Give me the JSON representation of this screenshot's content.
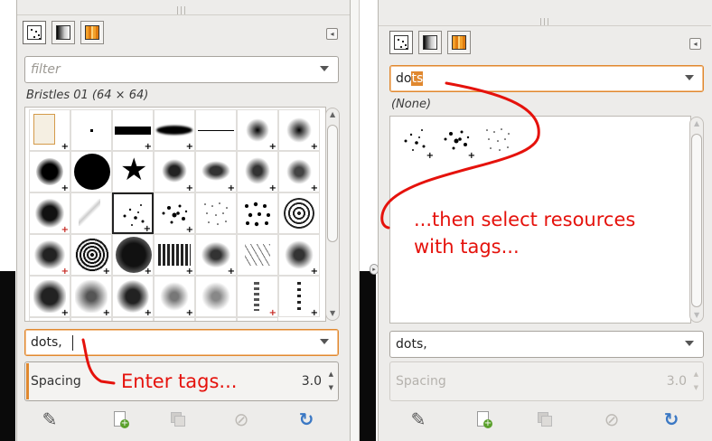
{
  "left_panel": {
    "filter": {
      "placeholder": "filter"
    },
    "selected_brush": "Bristles 01 (64 × 64)",
    "tags_field": {
      "value": "dots,"
    },
    "spacing": {
      "label": "Spacing",
      "value": "3.0"
    }
  },
  "right_panel": {
    "filter": {
      "value": "do",
      "highlight": "ts"
    },
    "selected_brush": "(None)",
    "tags_field": {
      "value": "dots,"
    },
    "spacing": {
      "label": "Spacing",
      "value": "3.0"
    }
  },
  "annotations": {
    "enter_tags": "Enter tags...",
    "select_line1": "...then select resources",
    "select_line2": "with tags..."
  },
  "colors": {
    "annotation": "#e5120c",
    "focus": "#e0882f"
  },
  "toolbar_icons": [
    "edit-brush-icon",
    "new-brush-icon",
    "duplicate-brush-icon",
    "delete-brush-icon",
    "refresh-brushes-icon"
  ]
}
